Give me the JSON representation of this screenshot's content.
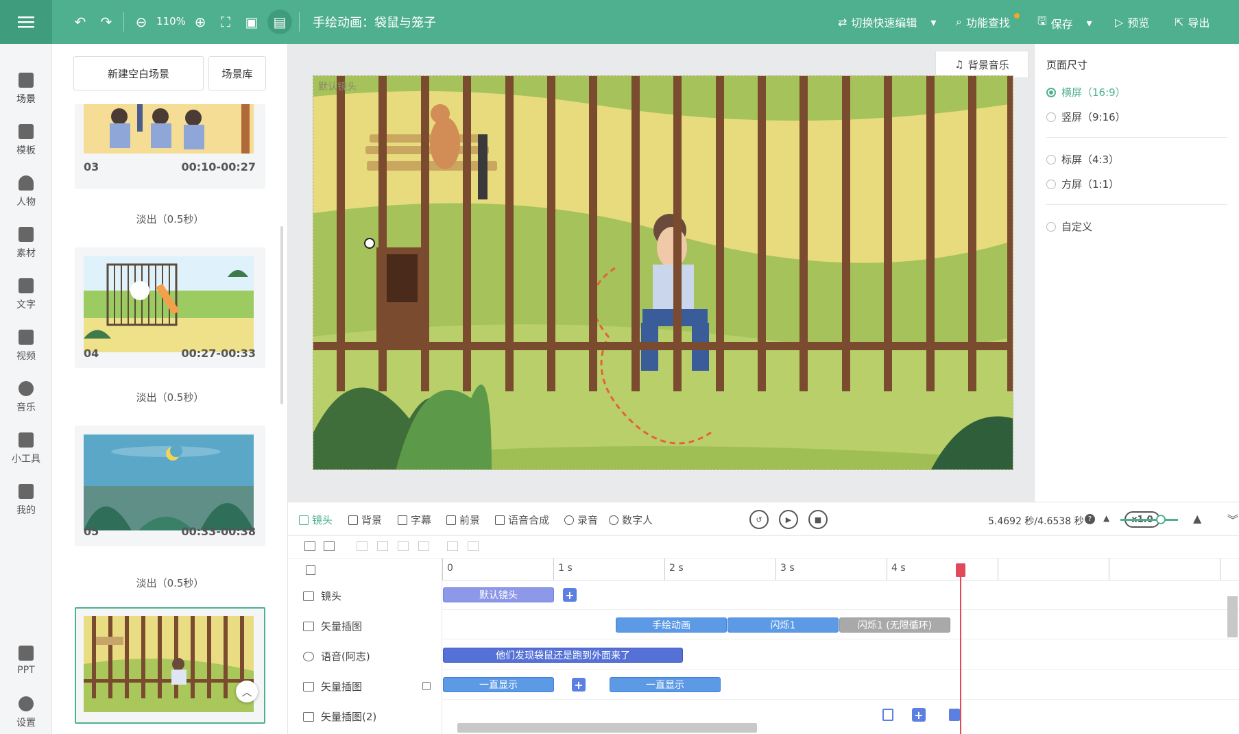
{
  "topbar": {
    "zoom": "110%",
    "title": "手绘动画：袋鼠与笼子",
    "switch_edit": "切换快速编辑",
    "find": "功能查找",
    "save": "保存",
    "preview": "预览",
    "export": "导出",
    "accent": "#4fb08f"
  },
  "leftnav": [
    {
      "label": "场景",
      "icon": "scene-icon"
    },
    {
      "label": "模板",
      "icon": "template-icon"
    },
    {
      "label": "人物",
      "icon": "person-icon"
    },
    {
      "label": "素材",
      "icon": "material-icon"
    },
    {
      "label": "文字",
      "icon": "text-icon"
    },
    {
      "label": "视频",
      "icon": "video-icon"
    },
    {
      "label": "音乐",
      "icon": "music-icon"
    },
    {
      "label": "小工具",
      "icon": "toolbox-icon"
    },
    {
      "label": "我的",
      "icon": "upload-icon"
    },
    {
      "label": "PPT",
      "icon": "ppt-icon"
    },
    {
      "label": "设置",
      "icon": "gear-icon"
    }
  ],
  "scenes": {
    "new_blank": "新建空白场景",
    "library": "场景库",
    "items": [
      {
        "num": "03",
        "time": "00:10-00:27"
      },
      {
        "num": "04",
        "time": "00:27-00:33"
      },
      {
        "num": "05",
        "time": "00:33-00:38"
      }
    ],
    "transition": "淡出（0.5秒）"
  },
  "canvas": {
    "bgm": "背景音乐",
    "camera_label": "默认镜头"
  },
  "page_size": {
    "title": "页面尺寸",
    "options": [
      "横屏（16:9）",
      "竖屏（9:16）",
      "标屏（4:3）",
      "方屏（1:1）",
      "自定义"
    ],
    "selected": 0
  },
  "timeline": {
    "tabs": [
      "镜头",
      "背景",
      "字幕",
      "前景",
      "语音合成",
      "录音",
      "数字人"
    ],
    "speed": "x1.0",
    "time": "5.4692 秒/4.6538 秒",
    "ruler": [
      "0",
      "1 s",
      "2 s",
      "3 s",
      "4 s"
    ],
    "tracks": [
      "镜头",
      "矢量插图",
      "语音(阿志)",
      "矢量插图",
      "矢量插图(2)"
    ],
    "clips": {
      "camera": "默认镜头",
      "vec1": [
        "手绘动画",
        "闪烁1",
        "闪烁1 (无限循环)"
      ],
      "voice": "他们发现袋鼠还是跑到外面来了",
      "vec2": [
        "一直显示",
        "一直显示"
      ]
    }
  }
}
